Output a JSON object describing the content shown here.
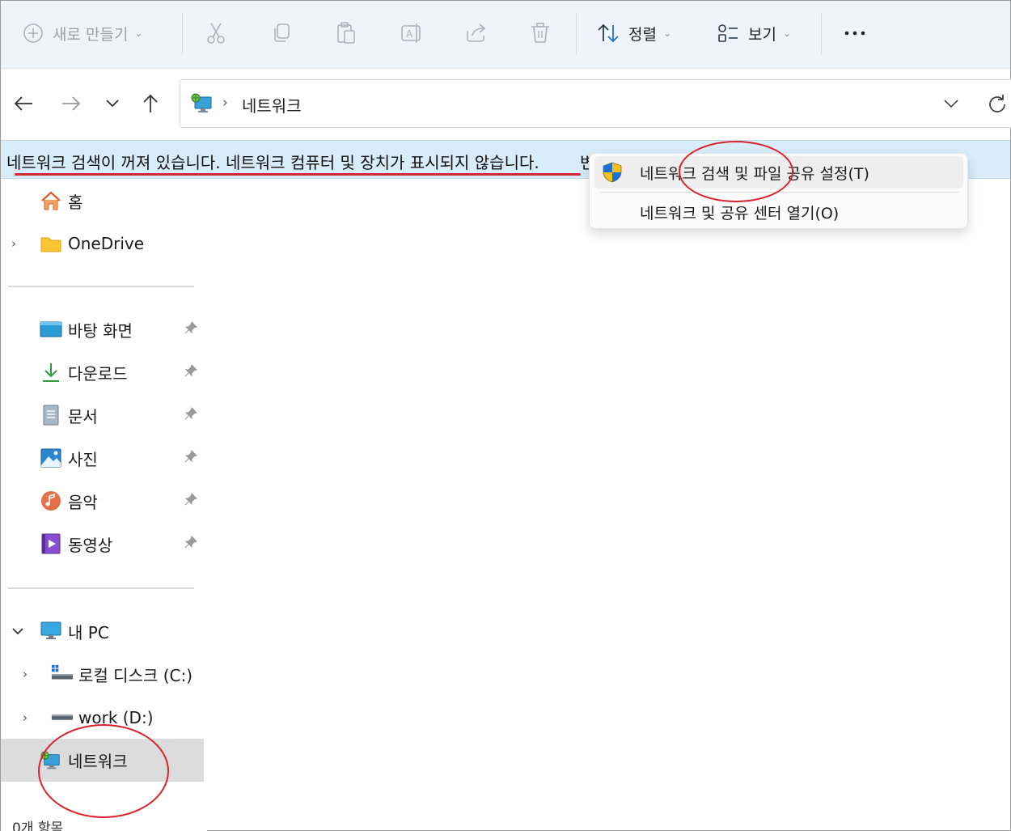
{
  "toolbar": {
    "new_label": "새로 만들기",
    "sort_label": "정렬",
    "view_label": "보기",
    "icons": [
      "plus-circle-icon",
      "cut-icon",
      "copy-icon",
      "paste-icon",
      "rename-icon",
      "share-icon",
      "delete-icon",
      "sort-icon",
      "view-icon",
      "more-icon"
    ]
  },
  "address": {
    "location": "네트워크",
    "icon": "network-icon"
  },
  "infobar": {
    "message": "네트워크 검색이 꺼져 있습니다. 네트워크 컴퓨터 및 장치가 표시되지 않습니다.",
    "tail": "변"
  },
  "context_menu": {
    "items": [
      {
        "label": "네트워크 검색 및 파일 공유 설정(T)",
        "icon": "uac-shield-icon"
      },
      {
        "label": "네트워크 및 공유 센터 열기(O)"
      }
    ]
  },
  "sidebar": {
    "home": "홈",
    "onedrive": "OneDrive",
    "quick": [
      {
        "label": "바탕 화면",
        "icon": "desktop-icon"
      },
      {
        "label": "다운로드",
        "icon": "download-icon"
      },
      {
        "label": "문서",
        "icon": "documents-icon"
      },
      {
        "label": "사진",
        "icon": "pictures-icon"
      },
      {
        "label": "음악",
        "icon": "music-icon"
      },
      {
        "label": "동영상",
        "icon": "videos-icon"
      }
    ],
    "this_pc": "내 PC",
    "drives": [
      {
        "label": "로컬 디스크 (C:)"
      },
      {
        "label": "work (D:)"
      }
    ],
    "network": "네트워크"
  },
  "status": {
    "count": "0개 항목"
  },
  "colors": {
    "toolbar_bg": "#eef4fa",
    "infobar_bg": "#d9ecf9",
    "annotation_red": "#d8242e",
    "selected_bg": "#dcdcdc"
  }
}
